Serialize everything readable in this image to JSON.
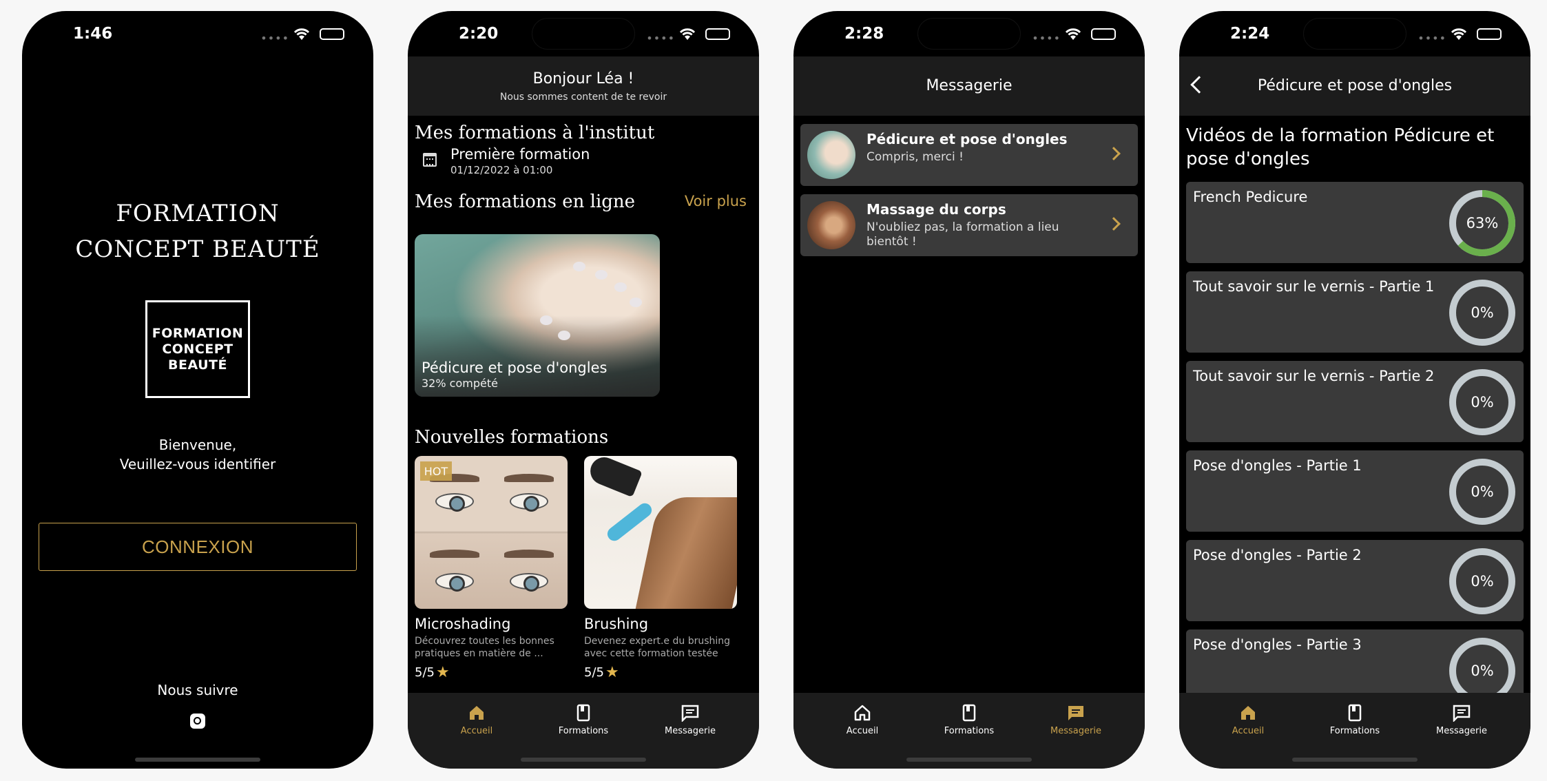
{
  "colors": {
    "accent": "#c9a24d",
    "progress_green": "#6ab04c",
    "ring_track": "#c4ccd0",
    "card_bg": "#3a3a3a",
    "bar_bg": "#1c1c1c"
  },
  "screen1": {
    "time": "1:46",
    "title_line1": "FORMATION",
    "title_line2": "CONCEPT BEAUTÉ",
    "logo_line1": "FORMATION",
    "logo_line2": "CONCEPT",
    "logo_line3": "BEAUTÉ",
    "welcome_line1": "Bienvenue,",
    "welcome_line2": "Veuillez-vous identifier",
    "login_button": "CONNEXION",
    "follow_label": "Nous suivre",
    "social_icon": "instagram-icon"
  },
  "screen2": {
    "time": "2:20",
    "greeting": "Bonjour Léa !",
    "greeting_sub": "Nous sommes content de te revoir",
    "section_institute": "Mes formations à l'institut",
    "event": {
      "name": "Première formation",
      "date": "01/12/2022 à 01:00",
      "icon": "calendar-icon"
    },
    "section_online": "Mes formations en ligne",
    "see_more": "Voir plus",
    "online_course": {
      "title": "Pédicure et pose d'ongles",
      "progress_text": "32% compété"
    },
    "section_new": "Nouvelles formations",
    "new_courses": [
      {
        "badge": "HOT",
        "title": "Microshading",
        "desc": "Découvrez toutes les bonnes pratiques en matière de ...",
        "rating": "5/5"
      },
      {
        "badge": "",
        "title": "Brushing",
        "desc": "Devenez expert.e du brushing avec cette formation testée et...",
        "rating": "5/5"
      }
    ]
  },
  "screen3": {
    "time": "2:28",
    "title": "Messagerie",
    "messages": [
      {
        "title": "Pédicure et pose d'ongles",
        "text": "Compris, merci !"
      },
      {
        "title": "Massage du corps",
        "text": "N'oubliez pas, la formation a lieu bientôt !"
      }
    ]
  },
  "screen4": {
    "time": "2:24",
    "title": "Pédicure et pose d'ongles",
    "videos_title": "Vidéos de la formation Pédicure et pose d'ongles",
    "videos": [
      {
        "name": "French Pedicure",
        "progress": 63,
        "label": "63%"
      },
      {
        "name": "Tout savoir sur le vernis - Partie 1",
        "progress": 0,
        "label": "0%"
      },
      {
        "name": "Tout savoir sur le vernis - Partie 2",
        "progress": 0,
        "label": "0%"
      },
      {
        "name": "Pose d'ongles - Partie 1",
        "progress": 0,
        "label": "0%"
      },
      {
        "name": "Pose d'ongles - Partie 2",
        "progress": 0,
        "label": "0%"
      },
      {
        "name": "Pose d'ongles - Partie 3",
        "progress": 0,
        "label": "0%"
      }
    ]
  },
  "tabs": [
    {
      "label": "Accueil",
      "icon": "home-icon"
    },
    {
      "label": "Formations",
      "icon": "book-icon"
    },
    {
      "label": "Messagerie",
      "icon": "chat-icon"
    }
  ]
}
